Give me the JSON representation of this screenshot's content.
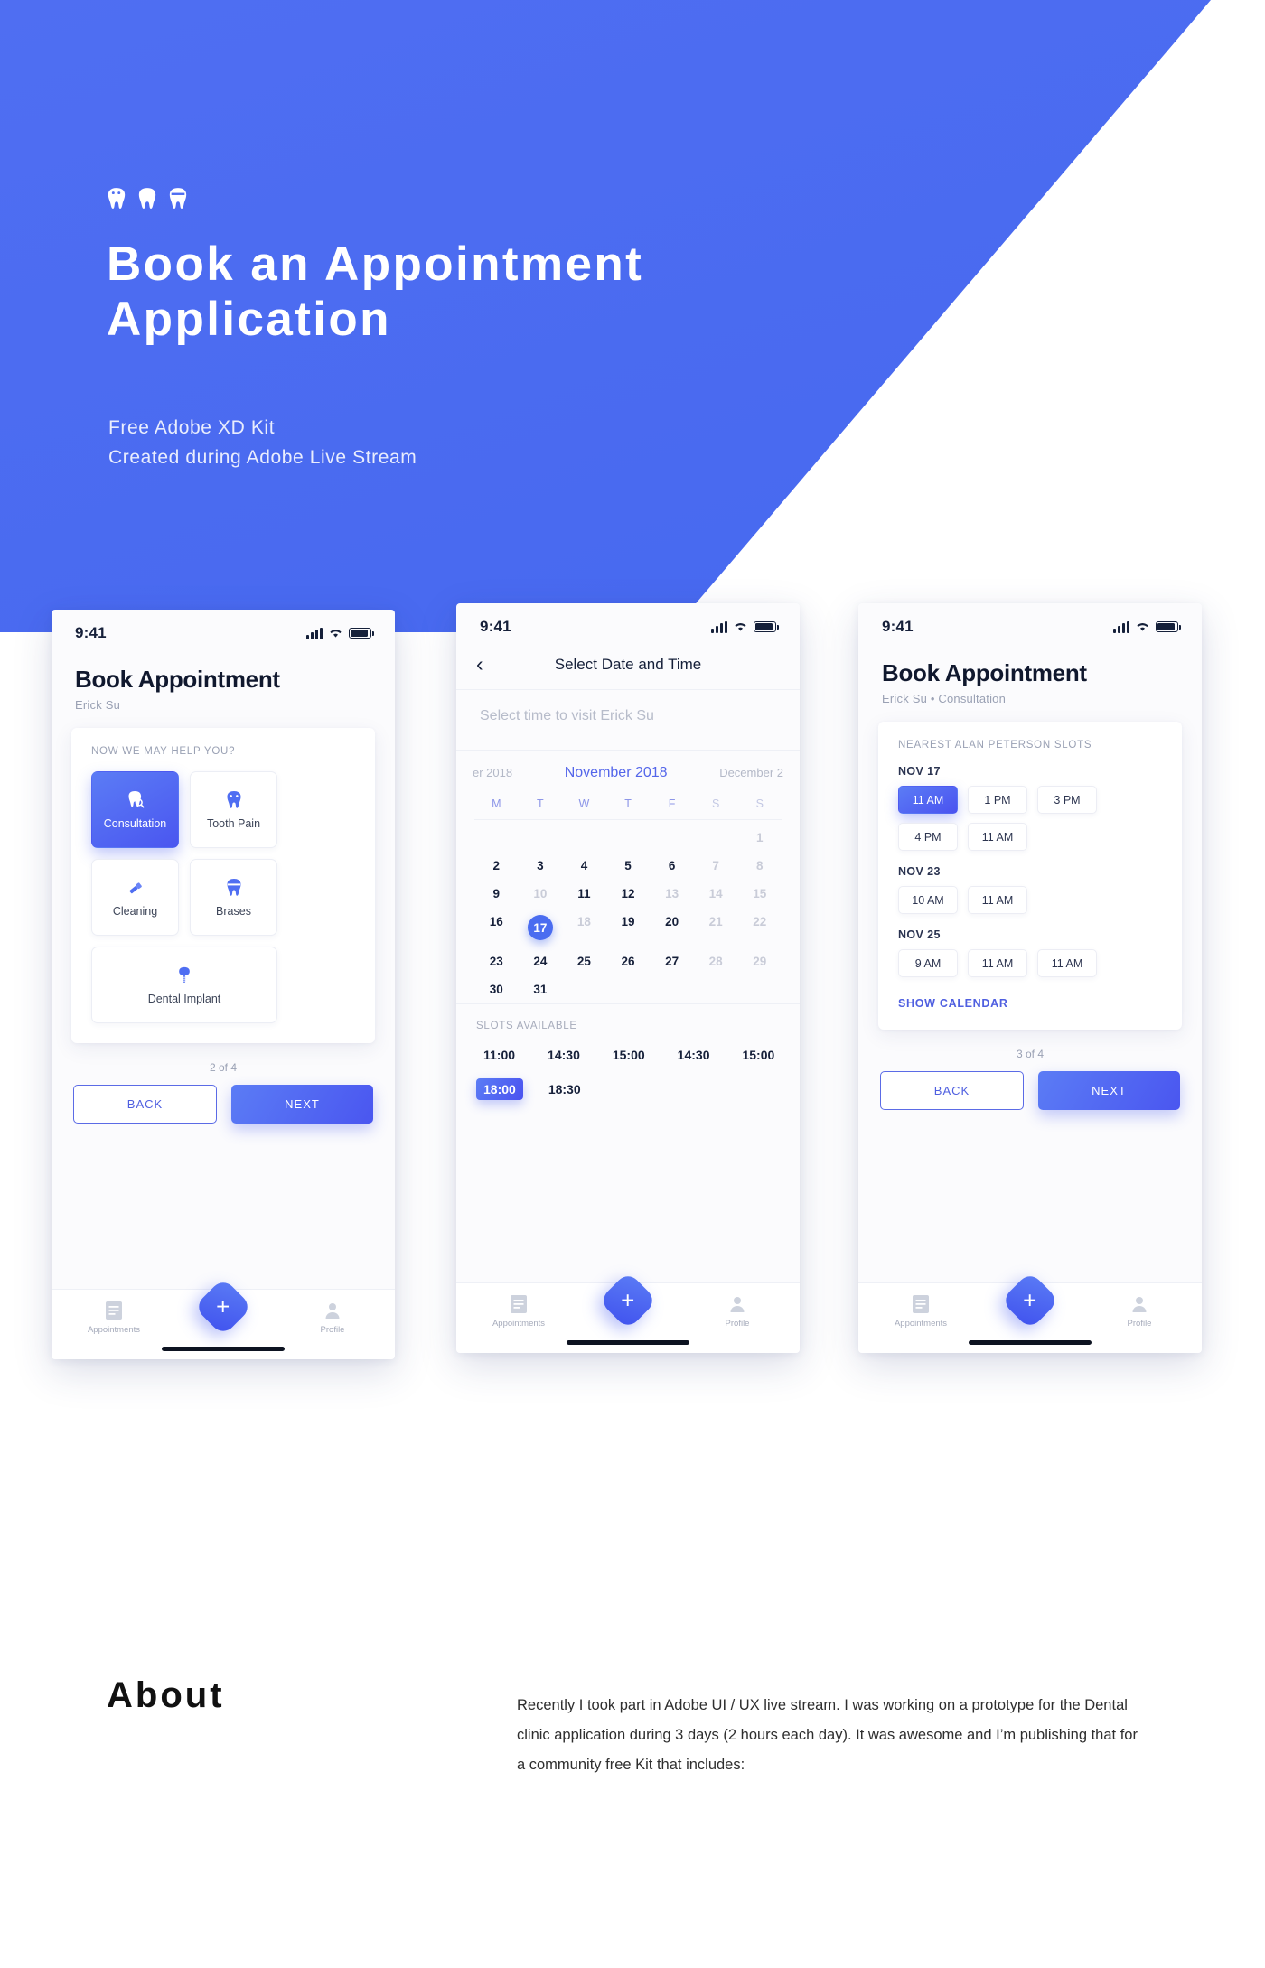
{
  "hero": {
    "icons": [
      "tooth-icon",
      "tooth-icon",
      "tooth-icon"
    ],
    "title": "Book an Appointment Application",
    "subtitle_line1": "Free Adobe XD Kit",
    "subtitle_line2": "Created during Adobe Live Stream",
    "background_color": "#4f6ef2"
  },
  "phone1": {
    "status": {
      "time": "9:41"
    },
    "title": "Book Appointment",
    "subtitle": "Erick Su",
    "card_label": "NOW WE MAY HELP YOU?",
    "services": [
      {
        "label": "Consultation",
        "icon": "tooth-search-icon",
        "selected": true
      },
      {
        "label": "Tooth Pain",
        "icon": "tooth-icon",
        "selected": false
      },
      {
        "label": "Cleaning",
        "icon": "brush-icon",
        "selected": false
      },
      {
        "label": "Brases",
        "icon": "braces-icon",
        "selected": false
      },
      {
        "label": "Dental Implant",
        "icon": "implant-icon",
        "selected": false
      }
    ],
    "pager": "2 of 4",
    "back_label": "BACK",
    "next_label": "NEXT",
    "tabs": [
      {
        "label": "Appointments",
        "icon": "list-icon"
      },
      {
        "label": "Profile",
        "icon": "person-icon"
      }
    ],
    "fab_label": "+"
  },
  "phone2": {
    "status": {
      "time": "9:41"
    },
    "nav_title": "Select Date and Time",
    "back_icon": "chevron-left-icon",
    "search_placeholder": "Select time to visit Erick Su",
    "calendar": {
      "prev_month": "er 2018",
      "current_month": "November 2018",
      "next_month": "December 2",
      "dow": [
        "M",
        "T",
        "W",
        "T",
        "F",
        "S",
        "S"
      ],
      "weeks": [
        [
          null,
          null,
          null,
          null,
          null,
          null,
          {
            "d": "1",
            "state": "muted"
          }
        ],
        [
          {
            "d": "2",
            "state": "on"
          },
          {
            "d": "3",
            "state": "on"
          },
          {
            "d": "4",
            "state": "on"
          },
          {
            "d": "5",
            "state": "on"
          },
          {
            "d": "6",
            "state": "on"
          },
          {
            "d": "7",
            "state": "muted"
          },
          {
            "d": "8",
            "state": "muted"
          }
        ],
        [
          {
            "d": "9",
            "state": "on"
          },
          {
            "d": "10",
            "state": "muted"
          },
          {
            "d": "11",
            "state": "on"
          },
          {
            "d": "12",
            "state": "on"
          },
          {
            "d": "13",
            "state": "muted"
          },
          {
            "d": "14",
            "state": "muted"
          },
          {
            "d": "15",
            "state": "muted"
          }
        ],
        [
          {
            "d": "16",
            "state": "on"
          },
          {
            "d": "17",
            "state": "selected"
          },
          {
            "d": "18",
            "state": "muted"
          },
          {
            "d": "19",
            "state": "on"
          },
          {
            "d": "20",
            "state": "on"
          },
          {
            "d": "21",
            "state": "muted"
          },
          {
            "d": "22",
            "state": "muted"
          }
        ],
        [
          {
            "d": "23",
            "state": "on"
          },
          {
            "d": "24",
            "state": "on"
          },
          {
            "d": "25",
            "state": "on"
          },
          {
            "d": "26",
            "state": "on"
          },
          {
            "d": "27",
            "state": "on"
          },
          {
            "d": "28",
            "state": "muted"
          },
          {
            "d": "29",
            "state": "muted"
          }
        ],
        [
          {
            "d": "30",
            "state": "on"
          },
          {
            "d": "31",
            "state": "on"
          },
          null,
          null,
          null,
          null,
          null
        ]
      ]
    },
    "slots_label": "SLOTS AVAILABLE",
    "slots_row1": [
      {
        "t": "11:00",
        "selected": false
      },
      {
        "t": "14:30",
        "selected": false
      },
      {
        "t": "15:00",
        "selected": false
      },
      {
        "t": "14:30",
        "selected": false
      },
      {
        "t": "15:00",
        "selected": false
      }
    ],
    "slots_row2": [
      {
        "t": "18:00",
        "selected": true
      },
      {
        "t": "18:30",
        "selected": false
      }
    ],
    "tabs": [
      {
        "label": "Appointments",
        "icon": "list-icon"
      },
      {
        "label": "Profile",
        "icon": "person-icon"
      }
    ],
    "fab_label": "+"
  },
  "phone3": {
    "status": {
      "time": "9:41"
    },
    "title": "Book Appointment",
    "subtitle": "Erick Su • Consultation",
    "card_label": "NEAREST ALAN PETERSON SLOTS",
    "groups": [
      {
        "day": "NOV 17",
        "rows": [
          [
            {
              "t": "11 AM",
              "selected": true
            },
            {
              "t": "1 PM",
              "selected": false
            },
            {
              "t": "3 PM",
              "selected": false
            }
          ],
          [
            {
              "t": "4 PM",
              "selected": false
            },
            {
              "t": "11 AM",
              "selected": false
            }
          ]
        ]
      },
      {
        "day": "NOV 23",
        "rows": [
          [
            {
              "t": "10 AM",
              "selected": false
            },
            {
              "t": "11 AM",
              "selected": false
            }
          ]
        ]
      },
      {
        "day": "NOV 25",
        "rows": [
          [
            {
              "t": "9 AM",
              "selected": false
            },
            {
              "t": "11 AM",
              "selected": false
            },
            {
              "t": "11 AM",
              "selected": false
            }
          ]
        ]
      }
    ],
    "show_calendar_label": "SHOW CALENDAR",
    "pager": "3 of 4",
    "back_label": "BACK",
    "next_label": "NEXT",
    "tabs": [
      {
        "label": "Appointments",
        "icon": "list-icon"
      },
      {
        "label": "Profile",
        "icon": "person-icon"
      }
    ],
    "fab_label": "+"
  },
  "about": {
    "heading": "About",
    "body": "Recently I took part in Adobe UI / UX live stream. I was working on a  prototype for the Dental clinic application during 3 days (2 hours each day). It was awesome and I’m publishing that for a community free Kit that includes:"
  },
  "colors": {
    "brand": "#4f6ef2",
    "brand_dark": "#4052ee",
    "text_dark": "#10182e",
    "text_muted": "#9aa1b4"
  }
}
